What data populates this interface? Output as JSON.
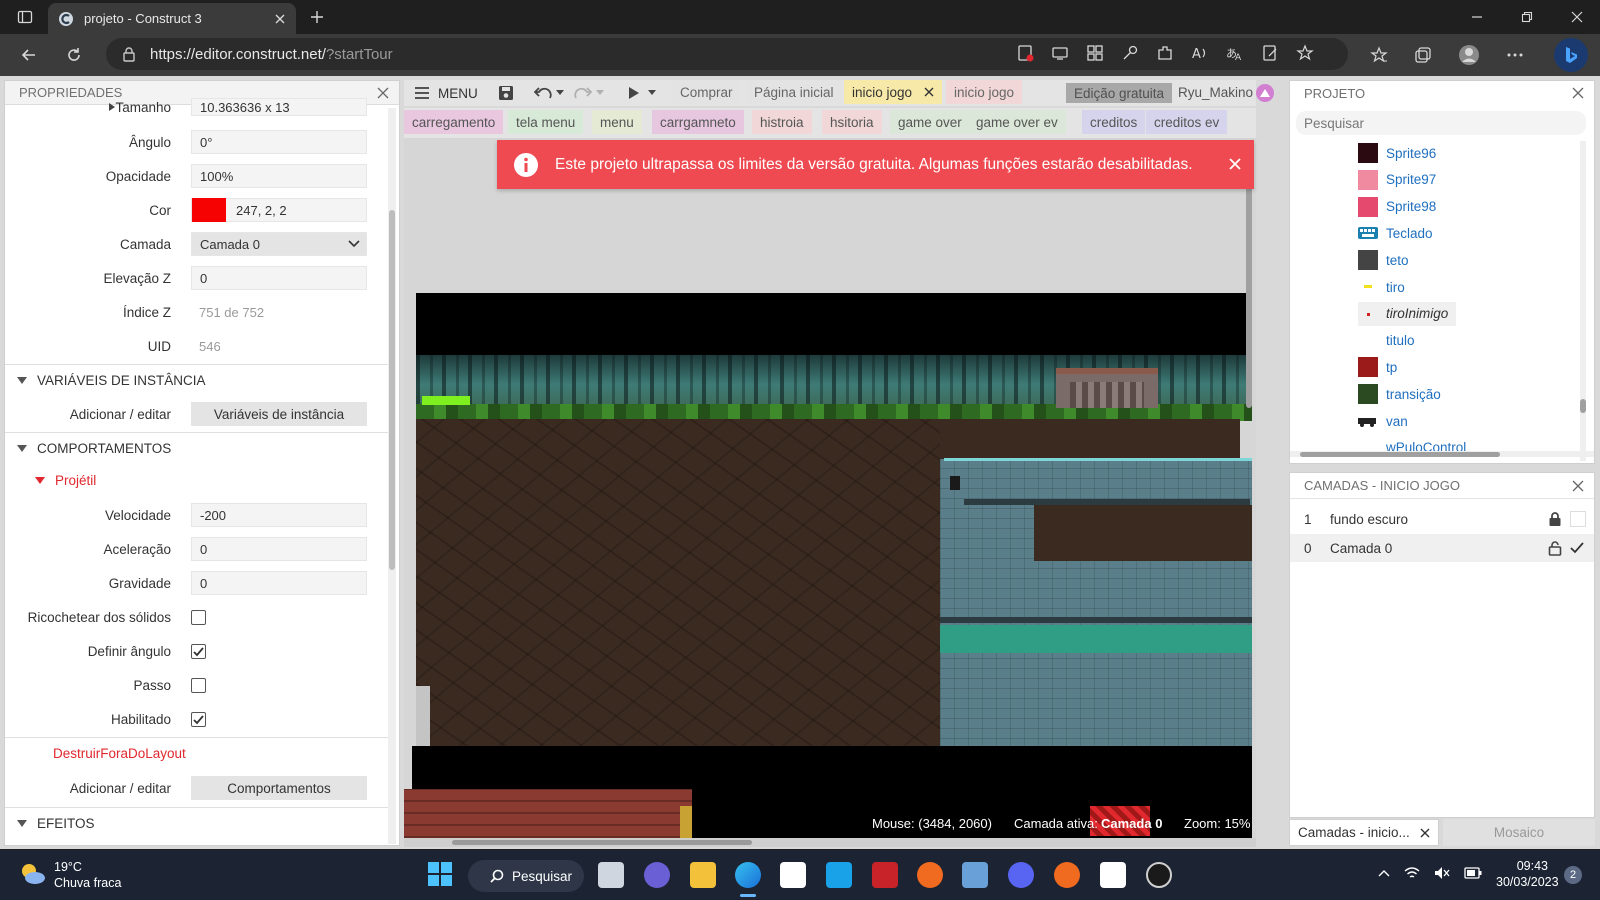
{
  "browser": {
    "tab_title": "projeto - Construct 3",
    "url_main": "https://editor.construct.net/",
    "url_path": "?startTour"
  },
  "properties": {
    "header": "PROPRIEDADES",
    "tamanho_label": "Tamanho",
    "tamanho_value": "10.363636  x 13",
    "rows": [
      {
        "label": "Ângulo",
        "value": "0°"
      },
      {
        "label": "Opacidade",
        "value": "100%"
      },
      {
        "label": "Cor",
        "value": "247, 2, 2"
      },
      {
        "label": "Camada",
        "value": "Camada 0"
      },
      {
        "label": "Elevação Z",
        "value": "0"
      },
      {
        "label": "Índice Z",
        "value": "751 de 752"
      },
      {
        "label": "UID",
        "value": "546"
      }
    ],
    "color_swatch": "#f70202",
    "instance_vars_header": "VARIÁVEIS DE INSTÂNCIA",
    "add_edit_label": "Adicionar / editar",
    "instance_vars_button": "Variáveis de instância",
    "behaviors_header": "COMPORTAMENTOS",
    "projectile_label": "Projétil",
    "behavior_rows": [
      {
        "label": "Velocidade",
        "value": "-200"
      },
      {
        "label": "Aceleração",
        "value": "0"
      },
      {
        "label": "Gravidade",
        "value": "0"
      }
    ],
    "checkbox_rows": [
      {
        "label": "Ricochetear dos sólidos",
        "checked": false
      },
      {
        "label": "Definir ângulo",
        "checked": true
      },
      {
        "label": "Passo",
        "checked": false
      },
      {
        "label": "Habilitado",
        "checked": true
      }
    ],
    "destroy_label": "DestruirForaDoLayout",
    "behaviors_button": "Comportamentos",
    "effects_header": "EFEITOS"
  },
  "toolbar": {
    "menu_label": "MENU",
    "comprar": "Comprar",
    "pagina_inicial": "Página inicial",
    "active_tab": "inicio jogo",
    "second_tab": "inicio jogo",
    "edition_badge": "Edição gratuita",
    "username": "Ryu_Makino"
  },
  "layout_tabs": [
    {
      "label": "carregamento",
      "color": "#e8c7df"
    },
    {
      "label": "tela menu",
      "color": "#d7e9d7"
    },
    {
      "label": "menu",
      "color": "#e4ead4"
    },
    {
      "label": "carrgamneto",
      "color": "#e7c7df"
    },
    {
      "label": "histroia",
      "color": "#f1d7d7"
    },
    {
      "label": "hsitoria",
      "color": "#f1d7d7"
    },
    {
      "label": "game over",
      "color": "#dbe7d8"
    },
    {
      "label": "game over ev",
      "color": "#dbe7d8"
    },
    {
      "label": "creditos",
      "color": "#d6d4ec"
    },
    {
      "label": "creditos ev",
      "color": "#d6d4ec"
    }
  ],
  "banner": {
    "message": "Este projeto ultrapassa os limites da versão gratuita. Algumas funções estarão desabilitadas."
  },
  "status": {
    "mouse": "Mouse: (3484, 2060)",
    "active_layer_label": "Camada ativa:",
    "active_layer_value": "Camada 0",
    "zoom": "Zoom: 15%"
  },
  "project": {
    "header": "PROJETO",
    "search_placeholder": "Pesquisar",
    "items": [
      {
        "name": "Sprite96",
        "color": "#2b0a12"
      },
      {
        "name": "Sprite97",
        "color": "#ef8aa0"
      },
      {
        "name": "Sprite98",
        "color": "#e54a6e"
      },
      {
        "name": "Teclado",
        "color": "#1b7fb0"
      },
      {
        "name": "teto",
        "color": "#444444"
      },
      {
        "name": "tiro",
        "color": "#f2e21b"
      },
      {
        "name": "tiroInimigo",
        "color": "#d12020"
      },
      {
        "name": "titulo",
        "color": "#ffffff"
      },
      {
        "name": "tp",
        "color": "#9b1b1b"
      },
      {
        "name": "transição",
        "color": "#2b4a22"
      },
      {
        "name": "van",
        "color": "#222222"
      },
      {
        "name": "wPuloControl",
        "color": "#ffffff"
      }
    ]
  },
  "layers": {
    "header": "CAMADAS - INICIO JOGO",
    "rows": [
      {
        "index": "1",
        "name": "fundo escuro"
      },
      {
        "index": "0",
        "name": "Camada 0"
      }
    ],
    "tab_active": "Camadas - inicio...",
    "tab_other": "Mosaico"
  },
  "taskbar": {
    "temperature": "19°C",
    "weather": "Chuva fraca",
    "search": "Pesquisar",
    "time": "09:43",
    "date": "30/03/2023",
    "notifications": "2"
  }
}
